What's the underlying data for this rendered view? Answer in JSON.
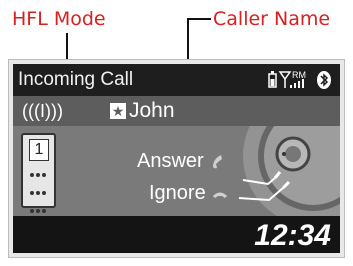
{
  "callouts": {
    "hfl_mode": "HFL Mode",
    "caller_name": "Caller Name"
  },
  "screen": {
    "title": "Incoming Call",
    "status": {
      "battery_icon": "battery-icon",
      "signal_icon": "signal-bars-icon",
      "roaming": "RM",
      "bluetooth_icon": "bluetooth-icon"
    },
    "caller": {
      "signal_indicator": "(((I)))",
      "favorite_icon": "star-icon",
      "name": "John"
    },
    "phone": {
      "line_number": "1"
    },
    "options": {
      "answer": "Answer",
      "ignore": "Ignore"
    },
    "clock": "12:34"
  },
  "colors": {
    "callout": "#d9201f",
    "screen_bg": "#1b1b1b",
    "panel_bg": "#7a7a7a"
  }
}
